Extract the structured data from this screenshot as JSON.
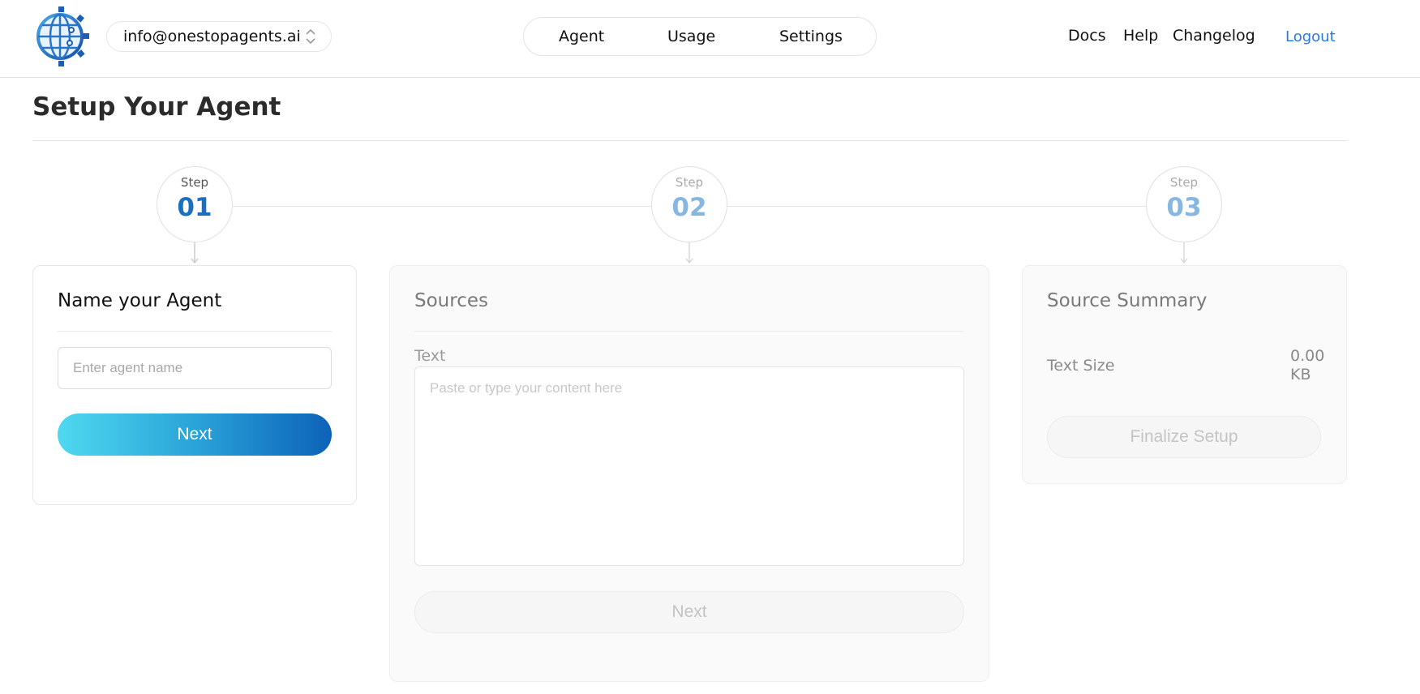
{
  "header": {
    "account_email": "info@onestopagents.ai",
    "nav": {
      "agent": "Agent",
      "usage": "Usage",
      "settings": "Settings"
    },
    "links": {
      "docs": "Docs",
      "help": "Help",
      "changelog": "Changelog",
      "logout": "Logout"
    }
  },
  "page": {
    "title": "Setup Your Agent"
  },
  "steps": [
    {
      "label": "Step",
      "number": "01"
    },
    {
      "label": "Step",
      "number": "02"
    },
    {
      "label": "Step",
      "number": "03"
    }
  ],
  "name_card": {
    "title": "Name your Agent",
    "input_placeholder": "Enter agent name",
    "input_value": "",
    "next_label": "Next"
  },
  "sources_card": {
    "title": "Sources",
    "text_label": "Text",
    "textarea_placeholder": "Paste or type your content here",
    "textarea_value": "",
    "next_label": "Next"
  },
  "summary_card": {
    "title": "Source Summary",
    "text_size_label": "Text Size",
    "text_size_value": "0.00 KB",
    "finalize_label": "Finalize Setup"
  },
  "colors": {
    "brand_blue": "#1a6fbf",
    "link_blue": "#2a7be0",
    "gradient_start": "#4fd9f0",
    "gradient_end": "#0d62b8"
  },
  "icons": {
    "logo": "globe-gear-logo",
    "account_switch": "chevron-up-down-icon",
    "step_arrow": "arrow-down-icon"
  }
}
